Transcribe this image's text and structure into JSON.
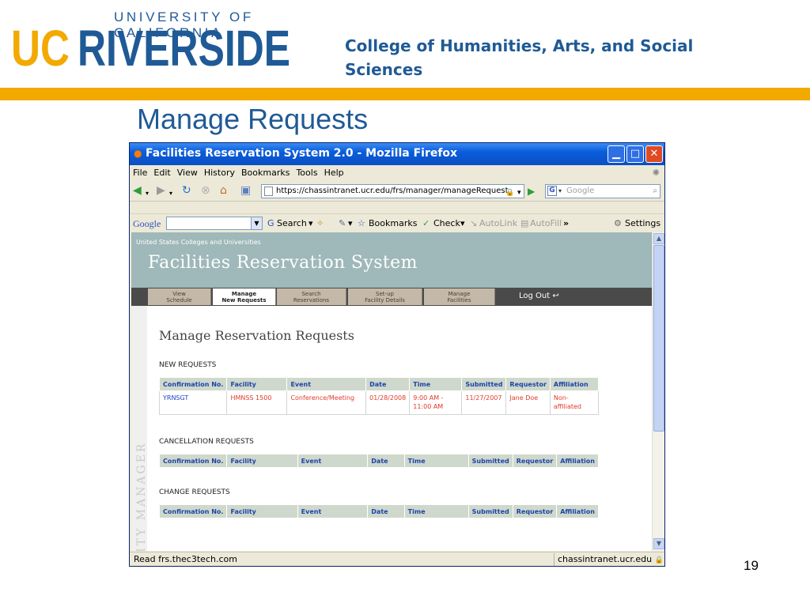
{
  "slide": {
    "logo_top": "UNIVERSITY OF CALIFORNIA",
    "logo_uc": "UC",
    "logo_riverside": "RIVERSIDE",
    "college": "College of Humanities, Arts, and Social Sciences",
    "title": "Manage Requests",
    "page_number": "19"
  },
  "colors": {
    "ucr_blue": "#1f5a96",
    "ucr_gold": "#f2a900",
    "banner": "#9fb8b9"
  },
  "window": {
    "title": "Facilities Reservation System 2.0 - Mozilla Firefox",
    "title_icon": "firefox-icon",
    "minimize_glyph": "▁",
    "maximize_glyph": "□",
    "close_glyph": "✕"
  },
  "menu": [
    "File",
    "Edit",
    "View",
    "History",
    "Bookmarks",
    "Tools",
    "Help"
  ],
  "nav": {
    "url": "https://chassintranet.ucr.edu/frs/manager/manageRequest",
    "search_placeholder": "Google",
    "search_engine_letter": "G",
    "icons": [
      "back-icon",
      "forward-icon",
      "reload-icon",
      "stop-icon",
      "home-icon",
      "new-tab-icon",
      "go-icon",
      "search-icon"
    ]
  },
  "google_toolbar": {
    "logo": "Google",
    "search": "Search",
    "bookmarks": "Bookmarks",
    "check": "Check",
    "autolink": "AutoLink",
    "autofill": "AutoFill",
    "more": "»",
    "settings": "Settings"
  },
  "frs": {
    "banner_small": "United States Colleges and Universities",
    "banner_title": "Facilities Reservation System",
    "tabs": [
      {
        "line1": "View",
        "line2": "Schedule",
        "active": false
      },
      {
        "line1": "Manage",
        "line2": "New Requests",
        "active": true
      },
      {
        "line1": "Search",
        "line2": "Reservations",
        "active": false
      },
      {
        "line1": "Set-up",
        "line2": "Facility Details",
        "active": false
      },
      {
        "line1": "Manage",
        "line2": "Facilities",
        "active": false
      }
    ],
    "logout": "Log Out",
    "sidebar_label": "FACILITY MANAGER",
    "page_title": "Manage Reservation Requests",
    "columns": [
      "Confirmation No.",
      "Facility",
      "Event",
      "Date",
      "Time",
      "Submitted",
      "Requestor",
      "Affiliation"
    ],
    "sections": {
      "new": {
        "title": "NEW REQUESTS",
        "rows": [
          {
            "confirmation": "YRNSGT",
            "facility": "HMNSS 1500",
            "event": "Conference/Meeting",
            "date": "01/28/2008",
            "time": "9:00 AM - 11:00 AM",
            "submitted": "11/27/2007",
            "requestor": "Jane Doe",
            "affiliation": "Non-affiliated"
          }
        ]
      },
      "cancellation": {
        "title": "CANCELLATION REQUESTS",
        "rows": []
      },
      "change": {
        "title": "CHANGE REQUESTS",
        "rows": []
      }
    }
  },
  "status": {
    "left": "Read frs.thec3tech.com",
    "right": "chassintranet.ucr.edu"
  }
}
